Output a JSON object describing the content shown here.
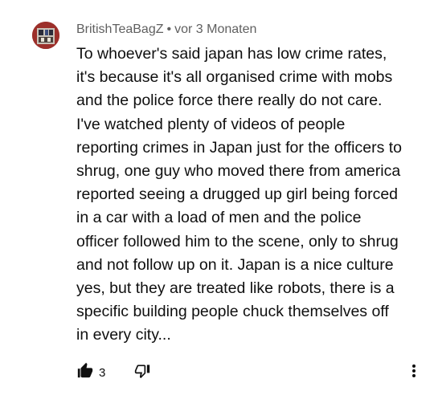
{
  "comment": {
    "author": "BritishTeaBagZ",
    "separator": "•",
    "timestamp": "vor 3 Monaten",
    "text": "To whoever's said japan has low crime rates,\nit's because it's all organised crime with mobs\nand the police force there really do not care.\nI've watched plenty of videos of people\nreporting crimes in Japan just for the officers to\nshrug, one guy who moved there from america\nreported seeing a drugged up girl being forced\nin a car with a load of men and the police\nofficer followed him to the scene, only to shrug\nand not follow up on it. Japan is a nice culture\nyes, but they are treated like robots, there is a\nspecific building people chuck themselves off\nin every city...",
    "like_count": "3"
  },
  "icons": {
    "like": "thumbs-up-filled-icon",
    "dislike": "thumbs-down-outline-icon",
    "more": "more-vertical-icon"
  },
  "colors": {
    "text": "#0f0f0f",
    "meta": "#606060",
    "avatar_bg": "#9c2f2a"
  }
}
